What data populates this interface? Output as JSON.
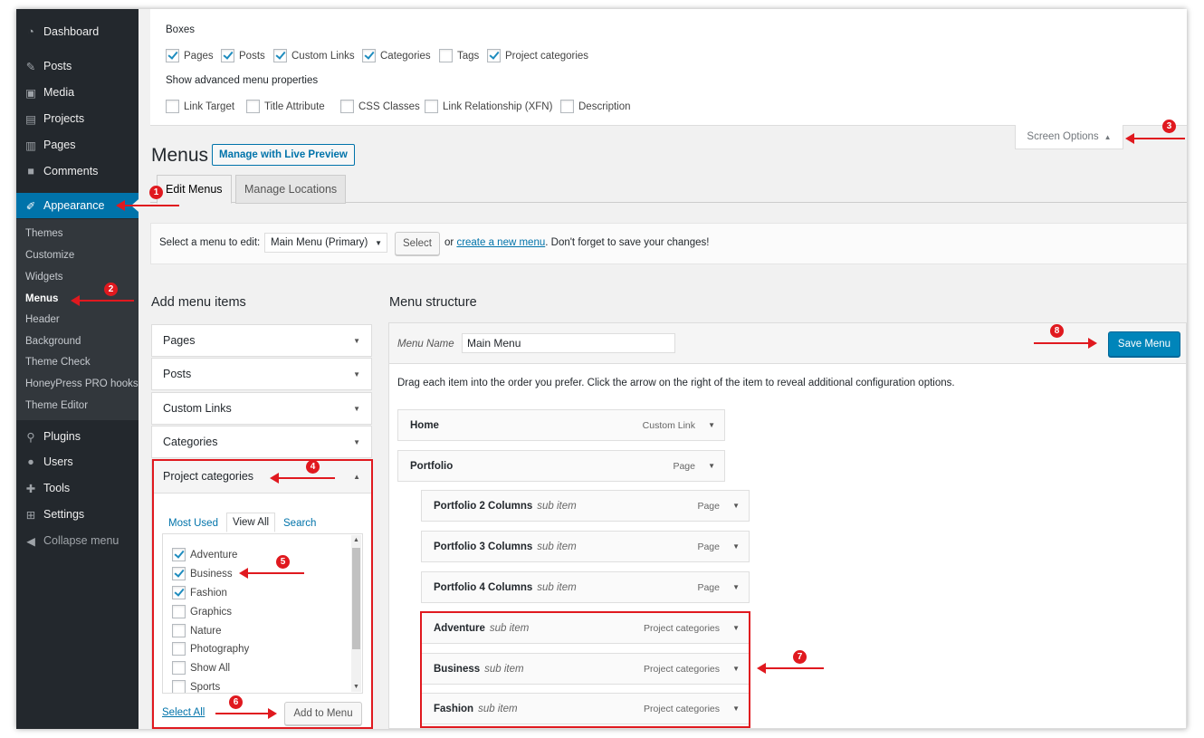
{
  "sidebar": {
    "items": [
      {
        "label": "Dashboard",
        "icon": "dashboard-icon"
      },
      {
        "label": "Posts",
        "icon": "pin-icon"
      },
      {
        "label": "Media",
        "icon": "media-icon"
      },
      {
        "label": "Projects",
        "icon": "projects-icon"
      },
      {
        "label": "Pages",
        "icon": "page-icon"
      },
      {
        "label": "Comments",
        "icon": "comment-icon"
      },
      {
        "label": "Appearance",
        "icon": "brush-icon"
      }
    ],
    "submenu": [
      "Themes",
      "Customize",
      "Widgets",
      "Menus",
      "Header",
      "Background",
      "Theme Check",
      "HoneyPress PRO hooks",
      "Theme Editor"
    ],
    "items_after": [
      {
        "label": "Plugins",
        "icon": "plugin-icon"
      },
      {
        "label": "Users",
        "icon": "user-icon"
      },
      {
        "label": "Tools",
        "icon": "wrench-icon"
      },
      {
        "label": "Settings",
        "icon": "settings-icon"
      }
    ],
    "collapse": "Collapse menu"
  },
  "screen_options": {
    "boxes_title": "Boxes",
    "boxes": [
      {
        "label": "Pages",
        "checked": true
      },
      {
        "label": "Posts",
        "checked": true
      },
      {
        "label": "Custom Links",
        "checked": true
      },
      {
        "label": "Categories",
        "checked": true
      },
      {
        "label": "Tags",
        "checked": false
      },
      {
        "label": "Project categories",
        "checked": true
      }
    ],
    "advanced_title": "Show advanced menu properties",
    "advanced": [
      {
        "label": "Link Target",
        "checked": false
      },
      {
        "label": "Title Attribute",
        "checked": false
      },
      {
        "label": "CSS Classes",
        "checked": false
      },
      {
        "label": "Link Relationship (XFN)",
        "checked": false
      },
      {
        "label": "Description",
        "checked": false
      }
    ],
    "tab_label": "Screen Options"
  },
  "header": {
    "title": "Menus",
    "live_preview": "Manage with Live Preview",
    "tabs": [
      "Edit Menus",
      "Manage Locations"
    ]
  },
  "manage_bar": {
    "label": "Select a menu to edit:",
    "selected": "Main Menu (Primary)",
    "select_button": "Select",
    "or": "or",
    "create_link": "create a new menu",
    "suffix": ". Don't forget to save your changes!"
  },
  "add_items": {
    "title": "Add menu items",
    "sections": [
      "Pages",
      "Posts",
      "Custom Links",
      "Categories"
    ],
    "open_section": "Project categories",
    "subtabs": [
      "Most Used",
      "View All",
      "Search"
    ],
    "list": [
      {
        "label": "Adventure",
        "checked": true
      },
      {
        "label": "Business",
        "checked": true
      },
      {
        "label": "Fashion",
        "checked": true
      },
      {
        "label": "Graphics",
        "checked": false
      },
      {
        "label": "Nature",
        "checked": false
      },
      {
        "label": "Photography",
        "checked": false
      },
      {
        "label": "Show All",
        "checked": false
      },
      {
        "label": "Sports",
        "checked": false
      }
    ],
    "select_all": "Select All",
    "add_button": "Add to Menu"
  },
  "structure": {
    "title": "Menu structure",
    "name_label": "Menu Name",
    "name_value": "Main Menu",
    "save_button": "Save Menu",
    "description": "Drag each item into the order you prefer. Click the arrow on the right of the item to reveal additional configuration options.",
    "items": [
      {
        "title": "Home",
        "sub": "",
        "type": "Custom Link"
      },
      {
        "title": "Portfolio",
        "sub": "",
        "type": "Page"
      },
      {
        "title": "Portfolio 2 Columns",
        "sub": "sub item",
        "type": "Page"
      },
      {
        "title": "Portfolio 3 Columns",
        "sub": "sub item",
        "type": "Page"
      },
      {
        "title": "Portfolio 4 Columns",
        "sub": "sub item",
        "type": "Page"
      },
      {
        "title": "Adventure",
        "sub": "sub item",
        "type": "Project categories"
      },
      {
        "title": "Business",
        "sub": "sub item",
        "type": "Project categories"
      },
      {
        "title": "Fashion",
        "sub": "sub item",
        "type": "Project categories"
      }
    ]
  },
  "annotations": [
    "1",
    "2",
    "3",
    "4",
    "5",
    "6",
    "7",
    "8"
  ],
  "colors": {
    "accent": "#0073aa",
    "primary_button": "#0085ba",
    "annotation": "#e0191f",
    "sidebar": "#23282d"
  }
}
